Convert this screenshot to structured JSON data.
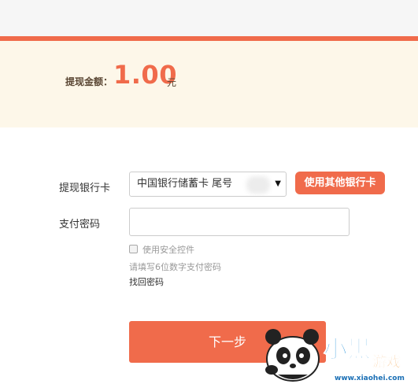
{
  "amount": {
    "label": "提现金额：",
    "value": "1.00",
    "unit": "元"
  },
  "form": {
    "bank_label": "提现银行卡",
    "bank_selected": "中国银行储蓄卡 尾号",
    "other_bank_button": "使用其他银行卡",
    "password_label": "支付密码",
    "security_control_label": "使用安全控件",
    "password_hint": "请填写6位数字支付密码",
    "forgot_password": "找回密码",
    "next_button": "下一步"
  },
  "watermark": {
    "brand": "小黑游戏",
    "url": "www.xiaohei.com"
  },
  "colors": {
    "accent": "#f06b4b",
    "panel": "#fdf7e9",
    "topbar": "#f6f6f6"
  }
}
